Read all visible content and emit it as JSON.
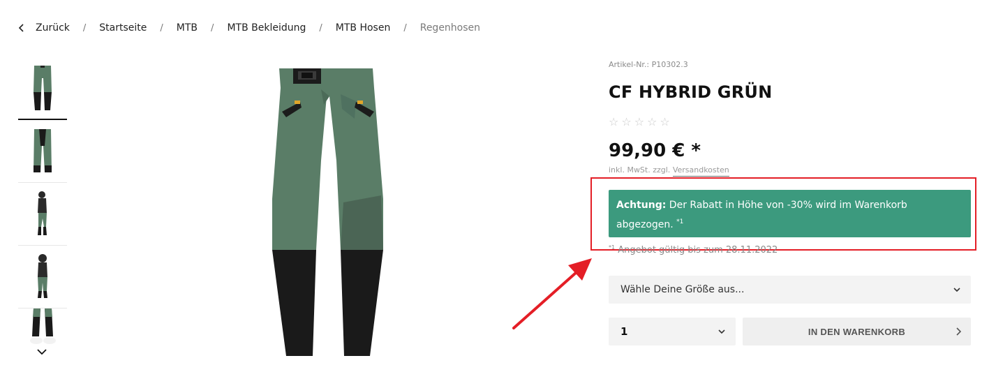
{
  "breadcrumb": {
    "back_label": "Zurück",
    "items": [
      "Startseite",
      "MTB",
      "MTB Bekleidung",
      "MTB Hosen"
    ],
    "current": "Regenhosen"
  },
  "product": {
    "article_number": "Artikel-Nr.: P10302.3",
    "title": "CF HYBRID GRÜN",
    "rating": 0,
    "stars_max": 5,
    "price": "99,90 € *",
    "tax_prefix": "inkl. MwSt. zzgl. ",
    "shipping_link": "Versandkosten"
  },
  "notice": {
    "bold": "Achtung:",
    "text": " Der Rabatt in Höhe von -30% wird im Warenkorb abgezogen. ",
    "footnote_mark": "*1"
  },
  "offer": {
    "footnote_mark": "*1",
    "text": " Angebot gültig bis zum 28.11.2022"
  },
  "size_select": {
    "placeholder": "Wähle Deine Größe aus..."
  },
  "quantity_select": {
    "value": "1"
  },
  "cart_button": {
    "label": "IN DEN WARENKORB"
  },
  "colors": {
    "accent_notice": "#3c9a7e",
    "highlight_box": "#e41e26",
    "pants_green": "#5a7d67",
    "pants_black": "#1a1a1a"
  }
}
